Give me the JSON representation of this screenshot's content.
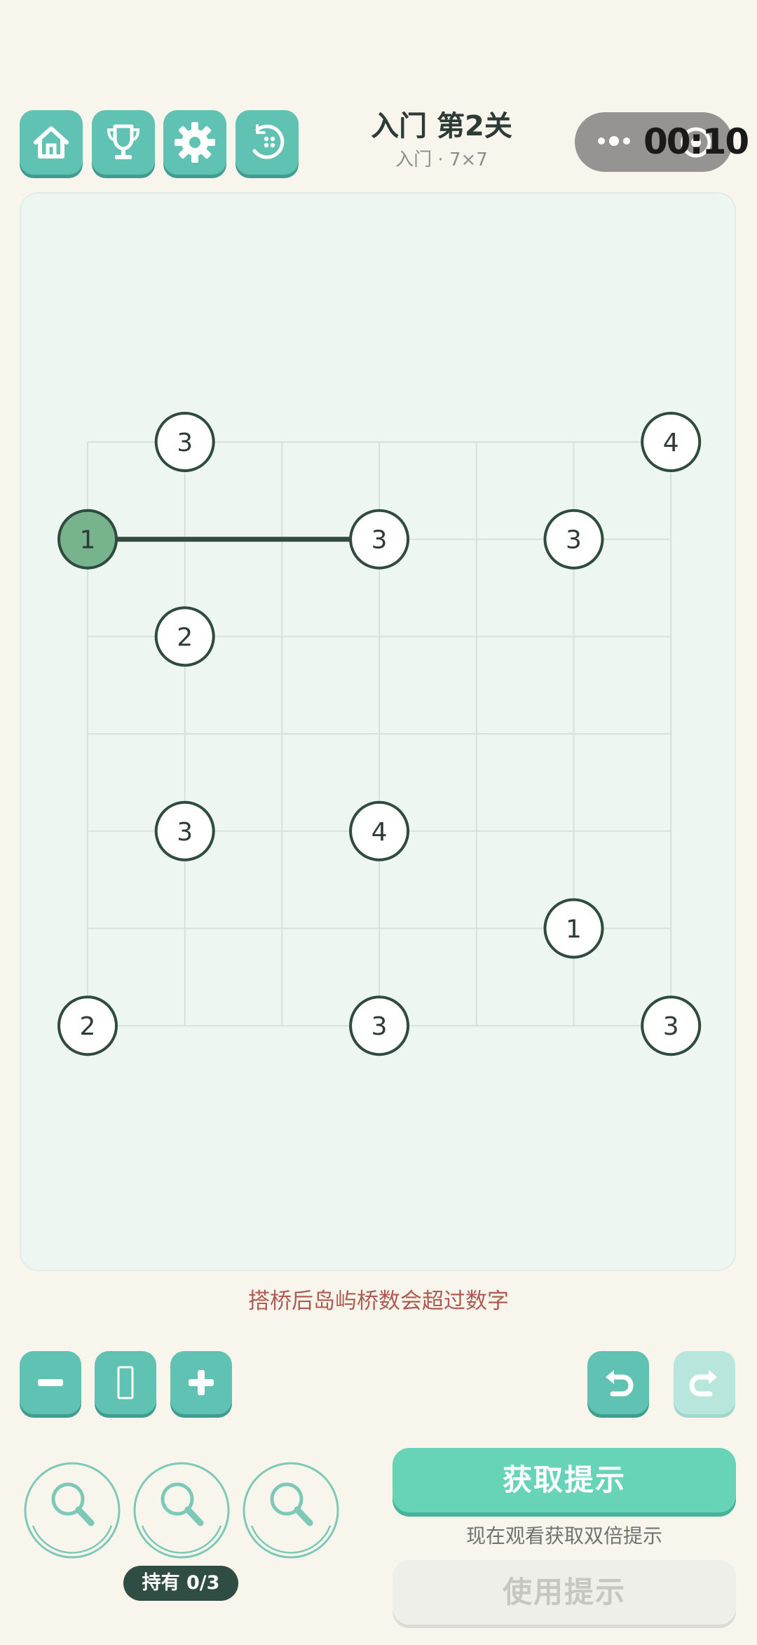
{
  "header": {
    "title": "入门 第2关",
    "subtitle": "入门 · 7×7",
    "timer": "00:10",
    "buttons": [
      {
        "name": "home",
        "icon": "house-icon"
      },
      {
        "name": "trophy",
        "icon": "trophy-icon"
      },
      {
        "name": "settings",
        "icon": "gear-icon"
      },
      {
        "name": "levels",
        "icon": "level-select-icon"
      }
    ]
  },
  "capsule": {
    "more_icon": "ellipsis-icon",
    "close_icon": "target-ring-icon"
  },
  "puzzle": {
    "grid_size": 7,
    "islands": [
      {
        "col": 1,
        "row": 0,
        "value": "3",
        "selected": false
      },
      {
        "col": 6,
        "row": 0,
        "value": "4",
        "selected": false
      },
      {
        "col": 0,
        "row": 1,
        "value": "1",
        "selected": true
      },
      {
        "col": 3,
        "row": 1,
        "value": "3",
        "selected": false
      },
      {
        "col": 5,
        "row": 1,
        "value": "3",
        "selected": false
      },
      {
        "col": 1,
        "row": 2,
        "value": "2",
        "selected": false
      },
      {
        "col": 1,
        "row": 4,
        "value": "3",
        "selected": false
      },
      {
        "col": 3,
        "row": 4,
        "value": "4",
        "selected": false
      },
      {
        "col": 5,
        "row": 5,
        "value": "1",
        "selected": false
      },
      {
        "col": 0,
        "row": 6,
        "value": "2",
        "selected": false
      },
      {
        "col": 3,
        "row": 6,
        "value": "3",
        "selected": false
      },
      {
        "col": 6,
        "row": 6,
        "value": "3",
        "selected": false
      }
    ],
    "bridges": [
      {
        "from": [
          0,
          1
        ],
        "to": [
          3,
          1
        ],
        "count": 1
      }
    ]
  },
  "message": "搭桥后岛屿桥数会超过数字",
  "toolbar": {
    "zoom_out_icon": "minus-icon",
    "fit_icon": "fit-frame-icon",
    "zoom_in_icon": "plus-icon",
    "undo_icon": "undo-icon",
    "redo_icon": "redo-icon"
  },
  "hints": {
    "slots": 3,
    "held_label": "持有 0/3",
    "get_hint_label": "获取提示",
    "double_hint_text": "现在观看获取双倍提示",
    "use_hint_label": "使用提示"
  },
  "colors": {
    "accent": "#5fc2b2",
    "get_hint": "#67d3b7",
    "selected_island": "#77b38d",
    "island_stroke": "#2f4a3f",
    "bridge": "#34493f",
    "message": "#b05a52"
  }
}
